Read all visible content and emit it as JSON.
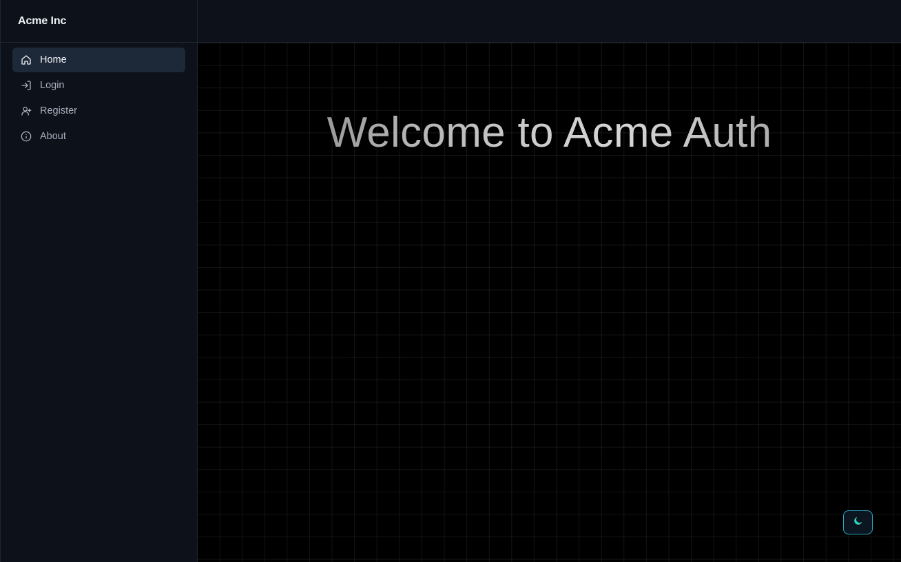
{
  "sidebar": {
    "brand": "Acme Inc",
    "items": [
      {
        "label": "Home",
        "icon": "home-icon",
        "active": true
      },
      {
        "label": "Login",
        "icon": "login-icon",
        "active": false
      },
      {
        "label": "Register",
        "icon": "user-plus-icon",
        "active": false
      },
      {
        "label": "About",
        "icon": "info-icon",
        "active": false
      }
    ]
  },
  "main": {
    "title": "Welcome to Acme Auth",
    "theme_toggle_icon": "moon-icon"
  },
  "colors": {
    "sidebar_bg": "#0c111a",
    "active_item_bg": "#1d2839",
    "accent": "#2dd4bf",
    "toggle_border": "#2aa9c4"
  }
}
